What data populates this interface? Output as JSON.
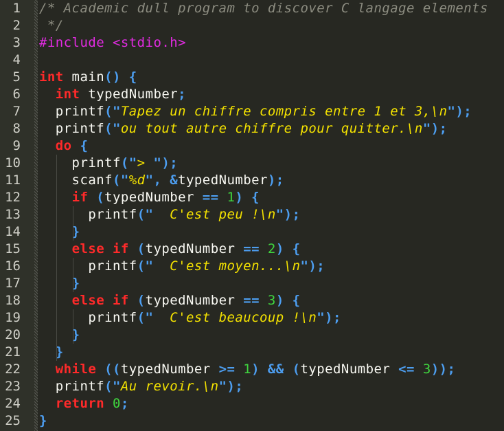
{
  "editor": {
    "colors": {
      "background": "#272822",
      "gutter": "#2f3129",
      "line_number": "#d0d0c8",
      "comment": "#8c8c80",
      "preprocessor": "#e22be2",
      "keyword": "#ff2a2a",
      "punctuation": "#4d9ef0",
      "identifier": "#f8f8f2",
      "string": "#f4e200",
      "number": "#3fd63f"
    },
    "lines": [
      {
        "n": "1",
        "tokens": [
          {
            "t": "comment",
            "v": "/* Academic dull program to discover C langage elements"
          }
        ]
      },
      {
        "n": "2",
        "tokens": [
          {
            "t": "comment",
            "v": " */"
          }
        ]
      },
      {
        "n": "3",
        "tokens": [
          {
            "t": "pre",
            "v": "#include <stdio.h>"
          }
        ]
      },
      {
        "n": "4",
        "tokens": []
      },
      {
        "n": "5",
        "tokens": [
          {
            "t": "kw",
            "v": "int"
          },
          {
            "t": "ident",
            "v": " main"
          },
          {
            "t": "punc",
            "v": "() {"
          }
        ]
      },
      {
        "n": "6",
        "tokens": [
          {
            "t": "ident",
            "v": "  "
          },
          {
            "t": "kw",
            "v": "int"
          },
          {
            "t": "ident",
            "v": " typedNumber"
          },
          {
            "t": "punc",
            "v": ";"
          }
        ]
      },
      {
        "n": "7",
        "tokens": [
          {
            "t": "ident",
            "v": "  printf"
          },
          {
            "t": "punc",
            "v": "(\""
          },
          {
            "t": "str",
            "v": "Tapez un chiffre compris entre 1 et 3,\\n"
          },
          {
            "t": "punc",
            "v": "\");"
          }
        ]
      },
      {
        "n": "8",
        "tokens": [
          {
            "t": "ident",
            "v": "  printf"
          },
          {
            "t": "punc",
            "v": "(\""
          },
          {
            "t": "str",
            "v": "ou tout autre chiffre pour quitter.\\n"
          },
          {
            "t": "punc",
            "v": "\");"
          }
        ]
      },
      {
        "n": "9",
        "tokens": [
          {
            "t": "ident",
            "v": "  "
          },
          {
            "t": "kw",
            "v": "do"
          },
          {
            "t": "punc",
            "v": " {"
          }
        ]
      },
      {
        "n": "10",
        "tokens": [
          {
            "t": "ident",
            "v": "    printf"
          },
          {
            "t": "punc",
            "v": "(\""
          },
          {
            "t": "str",
            "v": "> "
          },
          {
            "t": "punc",
            "v": "\");"
          }
        ]
      },
      {
        "n": "11",
        "tokens": [
          {
            "t": "ident",
            "v": "    scanf"
          },
          {
            "t": "punc",
            "v": "(\""
          },
          {
            "t": "str",
            "v": "%d"
          },
          {
            "t": "punc",
            "v": "\", &"
          },
          {
            "t": "ident",
            "v": "typedNumber"
          },
          {
            "t": "punc",
            "v": ");"
          }
        ]
      },
      {
        "n": "12",
        "tokens": [
          {
            "t": "ident",
            "v": "    "
          },
          {
            "t": "kw",
            "v": "if"
          },
          {
            "t": "punc",
            "v": " ("
          },
          {
            "t": "ident",
            "v": "typedNumber"
          },
          {
            "t": "punc",
            "v": " == "
          },
          {
            "t": "num",
            "v": "1"
          },
          {
            "t": "punc",
            "v": ") {"
          }
        ]
      },
      {
        "n": "13",
        "tokens": [
          {
            "t": "ident",
            "v": "      printf"
          },
          {
            "t": "punc",
            "v": "(\""
          },
          {
            "t": "str",
            "v": "  C'est peu !\\n"
          },
          {
            "t": "punc",
            "v": "\");"
          }
        ]
      },
      {
        "n": "14",
        "tokens": [
          {
            "t": "ident",
            "v": "    "
          },
          {
            "t": "punc",
            "v": "}"
          }
        ]
      },
      {
        "n": "15",
        "tokens": [
          {
            "t": "ident",
            "v": "    "
          },
          {
            "t": "kw",
            "v": "else if"
          },
          {
            "t": "punc",
            "v": " ("
          },
          {
            "t": "ident",
            "v": "typedNumber"
          },
          {
            "t": "punc",
            "v": " == "
          },
          {
            "t": "num",
            "v": "2"
          },
          {
            "t": "punc",
            "v": ") {"
          }
        ]
      },
      {
        "n": "16",
        "tokens": [
          {
            "t": "ident",
            "v": "      printf"
          },
          {
            "t": "punc",
            "v": "(\""
          },
          {
            "t": "str",
            "v": "  C'est moyen...\\n"
          },
          {
            "t": "punc",
            "v": "\");"
          }
        ]
      },
      {
        "n": "17",
        "tokens": [
          {
            "t": "ident",
            "v": "    "
          },
          {
            "t": "punc",
            "v": "}"
          }
        ]
      },
      {
        "n": "18",
        "tokens": [
          {
            "t": "ident",
            "v": "    "
          },
          {
            "t": "kw",
            "v": "else if"
          },
          {
            "t": "punc",
            "v": " ("
          },
          {
            "t": "ident",
            "v": "typedNumber"
          },
          {
            "t": "punc",
            "v": " == "
          },
          {
            "t": "num",
            "v": "3"
          },
          {
            "t": "punc",
            "v": ") {"
          }
        ]
      },
      {
        "n": "19",
        "tokens": [
          {
            "t": "ident",
            "v": "      printf"
          },
          {
            "t": "punc",
            "v": "(\""
          },
          {
            "t": "str",
            "v": "  C'est beaucoup !\\n"
          },
          {
            "t": "punc",
            "v": "\");"
          }
        ]
      },
      {
        "n": "20",
        "tokens": [
          {
            "t": "ident",
            "v": "    "
          },
          {
            "t": "punc",
            "v": "}"
          }
        ]
      },
      {
        "n": "21",
        "tokens": [
          {
            "t": "ident",
            "v": "  "
          },
          {
            "t": "punc",
            "v": "}"
          }
        ]
      },
      {
        "n": "22",
        "tokens": [
          {
            "t": "ident",
            "v": "  "
          },
          {
            "t": "kw",
            "v": "while"
          },
          {
            "t": "punc",
            "v": " (("
          },
          {
            "t": "ident",
            "v": "typedNumber"
          },
          {
            "t": "punc",
            "v": " >= "
          },
          {
            "t": "num",
            "v": "1"
          },
          {
            "t": "punc",
            "v": ") && ("
          },
          {
            "t": "ident",
            "v": "typedNumber"
          },
          {
            "t": "punc",
            "v": " <= "
          },
          {
            "t": "num",
            "v": "3"
          },
          {
            "t": "punc",
            "v": "));"
          }
        ]
      },
      {
        "n": "23",
        "tokens": [
          {
            "t": "ident",
            "v": "  printf"
          },
          {
            "t": "punc",
            "v": "(\""
          },
          {
            "t": "str",
            "v": "Au revoir.\\n"
          },
          {
            "t": "punc",
            "v": "\");"
          }
        ]
      },
      {
        "n": "24",
        "tokens": [
          {
            "t": "ident",
            "v": "  "
          },
          {
            "t": "kw",
            "v": "return"
          },
          {
            "t": "ident",
            "v": " "
          },
          {
            "t": "num",
            "v": "0"
          },
          {
            "t": "punc",
            "v": ";"
          }
        ]
      },
      {
        "n": "25",
        "tokens": [
          {
            "t": "punc",
            "v": "}"
          }
        ]
      }
    ]
  }
}
